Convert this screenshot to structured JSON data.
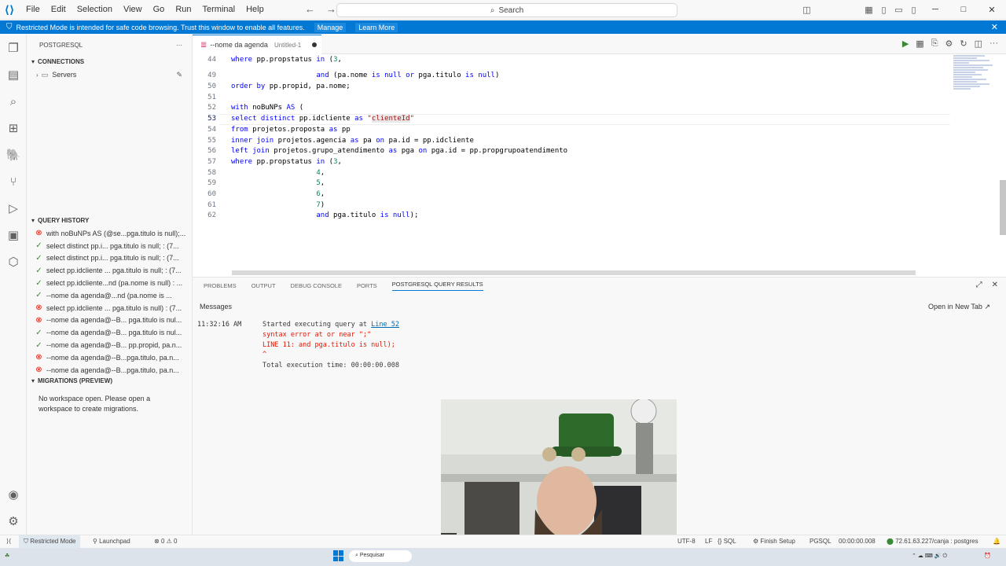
{
  "titlebar": {
    "menu": [
      "File",
      "Edit",
      "Selection",
      "View",
      "Go",
      "Run",
      "Terminal",
      "Help"
    ],
    "search_placeholder": "Search"
  },
  "banner": {
    "text": "Restricted Mode is intended for safe code browsing. Trust this window to enable all features.",
    "manage": "Manage",
    "learn_more": "Learn More"
  },
  "sidebar": {
    "title": "POSTGRESQL",
    "connections_header": "CONNECTIONS",
    "servers_label": "Servers",
    "history_header": "QUERY HISTORY",
    "history": [
      {
        "status": "err",
        "text": "with noBuNPs AS (@se...pga.titulo is null);..."
      },
      {
        "status": "ok",
        "text": "select distinct pp.i... pga.titulo is null; : (7..."
      },
      {
        "status": "ok",
        "text": "select distinct pp.i... pga.titulo is null; : (7..."
      },
      {
        "status": "ok",
        "text": "select pp.idcliente ... pga.titulo is null; : (7..."
      },
      {
        "status": "ok",
        "text": "select pp.idcliente...nd (pa.nome is null) : ..."
      },
      {
        "status": "ok",
        "text": "--nome da agenda@...nd (pa.nome is ..."
      },
      {
        "status": "err",
        "text": "select pp.idcliente ... pga.titulo is null) : (7..."
      },
      {
        "status": "err",
        "text": "--nome da agenda@--B... pga.titulo is nul..."
      },
      {
        "status": "ok",
        "text": "--nome da agenda@--B... pga.titulo is nul..."
      },
      {
        "status": "ok",
        "text": "--nome da agenda@--B... pp.propid, pa.n..."
      },
      {
        "status": "err",
        "text": "--nome da agenda@--B...pga.titulo, pa.n..."
      },
      {
        "status": "err",
        "text": "--nome da agenda@--B...pga.titulo, pa.n..."
      }
    ],
    "migrations_header": "MIGRATIONS (PREVIEW)",
    "migrations_text": "No workspace open. Please open a workspace to create migrations."
  },
  "editor": {
    "tab_title": "--nome da agenda",
    "tab_sub": "Untitled-1",
    "lines": [
      {
        "n": "44",
        "html": "<span class='kw'>where</span> pp.propstatus <span class='kw'>in</span> (<span class='n'>3</span>,"
      },
      {
        "n": "49",
        "html": "                    <span class='kw'>and</span> (pa.nome <span class='kw'>is null or</span> pga.titulo <span class='kw'>is null</span>)"
      },
      {
        "n": "50",
        "html": "<span class='kw'>order by</span> pp.propid, pa.nome;"
      },
      {
        "n": "51",
        "html": ""
      },
      {
        "n": "52",
        "html": "<span class='kw'>with</span> noBuNPs <span class='kw'>AS</span> ("
      },
      {
        "n": "53",
        "html": "<span class='kw'>select distinct</span> pp.idcliente <span class='kw'>as</span> <span class='str'>\"<span class='hl'>clienteId</span>\"</span>"
      },
      {
        "n": "54",
        "html": "<span class='kw'>from</span> projetos.proposta <span class='kw'>as</span> pp"
      },
      {
        "n": "55",
        "html": "<span class='kw'>inner join</span> projetos.agencia <span class='kw'>as</span> pa <span class='kw'>on</span> pa.id = pp.idcliente"
      },
      {
        "n": "56",
        "html": "<span class='kw'>left join</span> projetos.grupo_atendimento <span class='kw'>as</span> pga <span class='kw'>on</span> pga.id = pp.propgrupoatendimento"
      },
      {
        "n": "57",
        "html": "<span class='kw'>where</span> pp.propstatus <span class='kw'>in</span> (<span class='n'>3</span>,"
      },
      {
        "n": "58",
        "html": "                    <span class='n'>4</span>,"
      },
      {
        "n": "59",
        "html": "                    <span class='n'>5</span>,"
      },
      {
        "n": "60",
        "html": "                    <span class='n'>6</span>,"
      },
      {
        "n": "61",
        "html": "                    <span class='n'>7</span>)"
      },
      {
        "n": "62",
        "html": "                    <span class='kw'>and</span> pga.titulo <span class='kw'>is null</span>);"
      }
    ]
  },
  "panel": {
    "tabs": [
      "PROBLEMS",
      "OUTPUT",
      "DEBUG CONSOLE",
      "PORTS",
      "POSTGRESQL QUERY RESULTS"
    ],
    "messages_header": "Messages",
    "open_new_tab": "Open in New Tab",
    "time": "11:32:16 AM",
    "started": "Started executing query at ",
    "line_link": "Line 52",
    "error1": "syntax error at or near \";\"",
    "error2": "LINE 11: and pga.titulo is null);",
    "caret": "^",
    "total": "Total execution time: 00:00:00.008"
  },
  "status": {
    "restricted": "Restricted Mode",
    "launchpad": "Launchpad",
    "problems": "0",
    "warnings": "0",
    "encoding": "UTF-8",
    "eol": "LF",
    "lang": "SQL",
    "finish_setup": "Finish Setup",
    "pgsql": "PGSQL",
    "exec_time": "00:00:00.008",
    "connection": "72.61.63.227/canja : postgres"
  },
  "taskbar": {
    "search": "Pesquisar"
  }
}
